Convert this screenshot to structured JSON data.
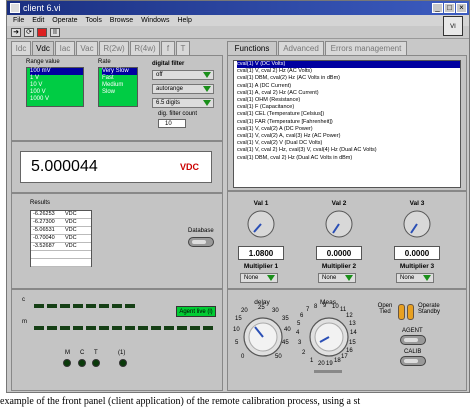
{
  "window": {
    "title": "client 6.vi",
    "menu": [
      "File",
      "Edit",
      "Operate",
      "Tools",
      "Browse",
      "Windows",
      "Help"
    ],
    "logo_text": "VI"
  },
  "left_tabs": [
    "Idc",
    "Vdc",
    "Iac",
    "Vac",
    "R(2w)",
    "R(4w)",
    "f",
    "T"
  ],
  "left_active_tab": "Vdc",
  "range": {
    "label": "Range value",
    "items": [
      "100 mV",
      "1 V",
      "10 V",
      "100 V",
      "1000 V"
    ],
    "selected": "100 mV"
  },
  "rate": {
    "label": "Rate",
    "items": [
      "Very Slow",
      "Fast",
      "Medium",
      "Slow"
    ],
    "selected": "Very Slow"
  },
  "digital_filter": {
    "label": "digital filter",
    "mode": "off",
    "range_mode": "autorange",
    "digits": "6.5 digits",
    "count_label": "dig. filter count",
    "count": "10"
  },
  "reading": {
    "value": "5.000044",
    "unit": "VDC"
  },
  "results": {
    "label": "Results",
    "rows": [
      {
        "value": "-6.26253",
        "unit": "VDC"
      },
      {
        "value": "-6.27300",
        "unit": "VDC"
      },
      {
        "value": "-5.06531",
        "unit": "VDC"
      },
      {
        "value": "-0.70040",
        "unit": "VDC"
      },
      {
        "value": "-3.52687",
        "unit": "VDC"
      },
      {
        "value": "",
        "unit": ""
      },
      {
        "value": "",
        "unit": ""
      }
    ],
    "database_label": "Database"
  },
  "right_tabs": [
    "Functions",
    "Advanced",
    "Errors management"
  ],
  "right_active_tab": "Functions",
  "functions": [
    "cval(1) V    (DC Volts)",
    "cval(1) V, cval 2) Hz    (AC Volts)",
    "cval(1) DBM, cval(2) Hz    (AC Volts in dBm)",
    "cval(1) A    (DC Current)",
    "cval(1) A, cval 2) Hz    (AC Current)",
    "cval(1) OHM    (Resistance)",
    "cval(1) F    (Capacitance)",
    "cval(1) CEL    (Temperature [Celsius])",
    "cval(1) FAR    (Temperature [Fahrenheit])",
    "cval(1) V, cval(2) A    (DC Power)",
    "cval(1) V, cval(2) A, cval(3) Hz    (AC Power)",
    "cval(1) V, cval(2) V    (Dual DC Volts)",
    "cval(1) V, cval 2) Hz, cval(3) V, cval(4) Hz    (Dual AC Volts)",
    "cval(1) DBM, cval 2) Hz    (Dual AC Volts in dBm)"
  ],
  "functions_selected": 0,
  "vals": [
    {
      "label": "Val 1",
      "value": "1.0800",
      "mult_label": "Multiplier 1",
      "mult": "None"
    },
    {
      "label": "Val 2",
      "value": "0.0000",
      "mult_label": "Multiplier 2",
      "mult": "None"
    },
    {
      "label": "Val 3",
      "value": "0.0000",
      "mult_label": "Multiplier 3",
      "mult": "None"
    }
  ],
  "indicators": {
    "row_labels": [
      "c",
      "m"
    ],
    "agent_label": "Agent live (l)",
    "leds": [
      "M",
      "C",
      "T",
      "(1)"
    ]
  },
  "delay": {
    "label": "delay",
    "ticks": [
      "0",
      "5",
      "10",
      "15",
      "20",
      "25",
      "30",
      "35",
      "40",
      "45",
      "50"
    ]
  },
  "meas": {
    "label": "Meas",
    "ticks": [
      "1",
      "2",
      "3",
      "4",
      "5",
      "6",
      "7",
      "8",
      "9",
      "10",
      "11",
      "12",
      "13",
      "14",
      "15",
      "16",
      "17",
      "18",
      "19",
      "20"
    ]
  },
  "mode": {
    "left": "Open Tied",
    "right": "Operate Standby"
  },
  "buttons": {
    "agent": "AGENT",
    "calib": "CALIB"
  },
  "caption": "example of the front panel (client application) of the remote calibration process, using a st"
}
